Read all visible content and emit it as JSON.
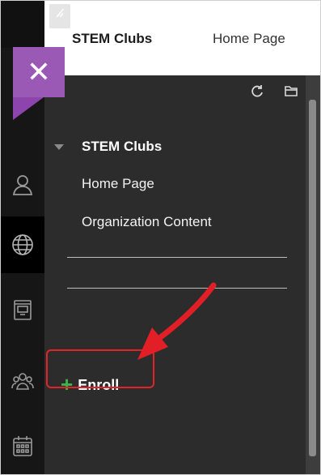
{
  "header": {
    "course_title": "STEM Clubs",
    "page_title": "Home Page",
    "pin_glyph": "𝒽"
  },
  "close_tab": {
    "glyph": "✕",
    "color": "#9b59b6"
  },
  "panel": {
    "course_item": "STEM Clubs",
    "links": [
      "Home Page",
      "Organization Content"
    ],
    "enroll_label": "Enroll"
  },
  "rail_icons": [
    "profile-icon",
    "globe-icon",
    "courses-icon",
    "organizations-icon",
    "calendar-icon"
  ],
  "annotation": {
    "highlight_color": "#e0242a",
    "arrow_color": "#e21f26"
  }
}
